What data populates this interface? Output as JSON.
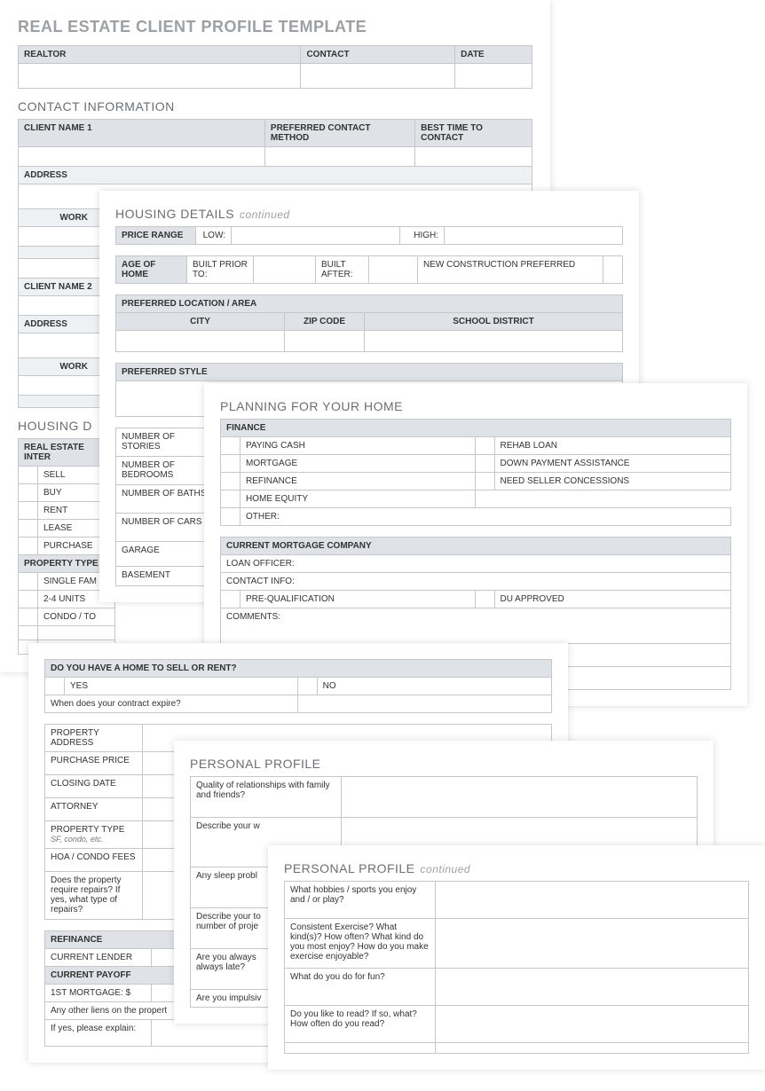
{
  "page1": {
    "title": "REAL ESTATE CLIENT PROFILE TEMPLATE",
    "top_headers": [
      "REALTOR",
      "CONTACT",
      "DATE"
    ],
    "contact_heading": "CONTACT INFORMATION",
    "contact_headers1": [
      "CLIENT NAME 1",
      "PREFERRED CONTACT METHOD",
      "BEST TIME TO CONTACT"
    ],
    "address_label": "ADDRESS",
    "work_label": "WORK",
    "client2_label": "CLIENT NAME 2",
    "housing_heading": "HOUSING D",
    "interest_label": "REAL ESTATE INTER",
    "interest_items": [
      "SELL",
      "BUY",
      "RENT",
      "LEASE",
      "PURCHASE"
    ],
    "property_type_label": "PROPERTY TYPE",
    "property_items": [
      "SINGLE FAM",
      "2-4 UNITS",
      "CONDO / TO"
    ]
  },
  "page2": {
    "heading": "HOUSING DETAILS",
    "cont": "continued",
    "price_range": "PRICE RANGE",
    "low": "LOW:",
    "high": "HIGH:",
    "age_of_home": "AGE OF HOME",
    "built_prior": "BUILT PRIOR TO:",
    "built_after": "BUILT AFTER:",
    "new_construction": "NEW CONSTRUCTION PREFERRED",
    "pref_location": "PREFERRED LOCATION / AREA",
    "city": "CITY",
    "zip": "ZIP CODE",
    "school": "SCHOOL DISTRICT",
    "pref_style": "PREFERRED STYLE",
    "num_stories": "NUMBER OF STORIES",
    "num_bedrooms": "NUMBER OF BEDROOMS",
    "num_baths": "NUMBER OF BATHS",
    "num_cars": "NUMBER OF CARS",
    "garage": "GARAGE",
    "basement": "BASEMENT"
  },
  "page3": {
    "heading": "PLANNING FOR YOUR HOME",
    "finance": "FINANCE",
    "finance_left": [
      "PAYING CASH",
      "MORTGAGE",
      "REFINANCE",
      "HOME EQUITY"
    ],
    "other": "OTHER:",
    "finance_right": [
      "REHAB LOAN",
      "DOWN PAYMENT ASSISTANCE",
      "NEED SELLER CONCESSIONS"
    ],
    "mortgage_company": "CURRENT MORTGAGE COMPANY",
    "loan_officer": "LOAN OFFICER:",
    "contact_info": "CONTACT INFO:",
    "pre_qual": "PRE-QUALIFICATION",
    "du_approved": "DU APPROVED",
    "comments": "COMMENTS:"
  },
  "page4": {
    "sell_rent_q": "DO YOU HAVE A HOME TO SELL OR RENT?",
    "yes": "YES",
    "no": "NO",
    "contract_expire": "When does your contract expire?",
    "rows": [
      "PROPERTY ADDRESS",
      "PURCHASE PRICE",
      "CLOSING DATE",
      "ATTORNEY"
    ],
    "property_type": "PROPERTY TYPE",
    "property_type_sub": "SF, condo, etc.",
    "hoa": "HOA / CONDO FEES",
    "repairs_q": "Does the property require repairs? If yes, what type of repairs?",
    "refinance": "REFINANCE",
    "current_lender": "CURRENT LENDER",
    "current_payoff": "CURRENT PAYOFF",
    "first_mortgage": "1ST MORTGAGE: $",
    "liens": "Any other liens on the propert",
    "explain": "If yes, please explain:"
  },
  "page5": {
    "heading": "PERSONAL PROFILE",
    "q1": "Quality of relationships with family and friends?",
    "q2": "Describe your w",
    "q3": "Any sleep probl",
    "q4": "Describe your to",
    "q4b": "number of proje",
    "q5": "Are you always",
    "q5b": "always late?",
    "q6": "Are you impulsiv"
  },
  "page6": {
    "heading": "PERSONAL PROFILE",
    "cont": "continued",
    "q1": "What hobbies / sports you enjoy and / or play?",
    "q2": "Consistent Exercise? What kind(s)? How often? What kind do you most enjoy? How do you make exercise enjoyable?",
    "q3": "What do you do for fun?",
    "q4": "Do you like to read? If so, what? How often do you read?"
  }
}
